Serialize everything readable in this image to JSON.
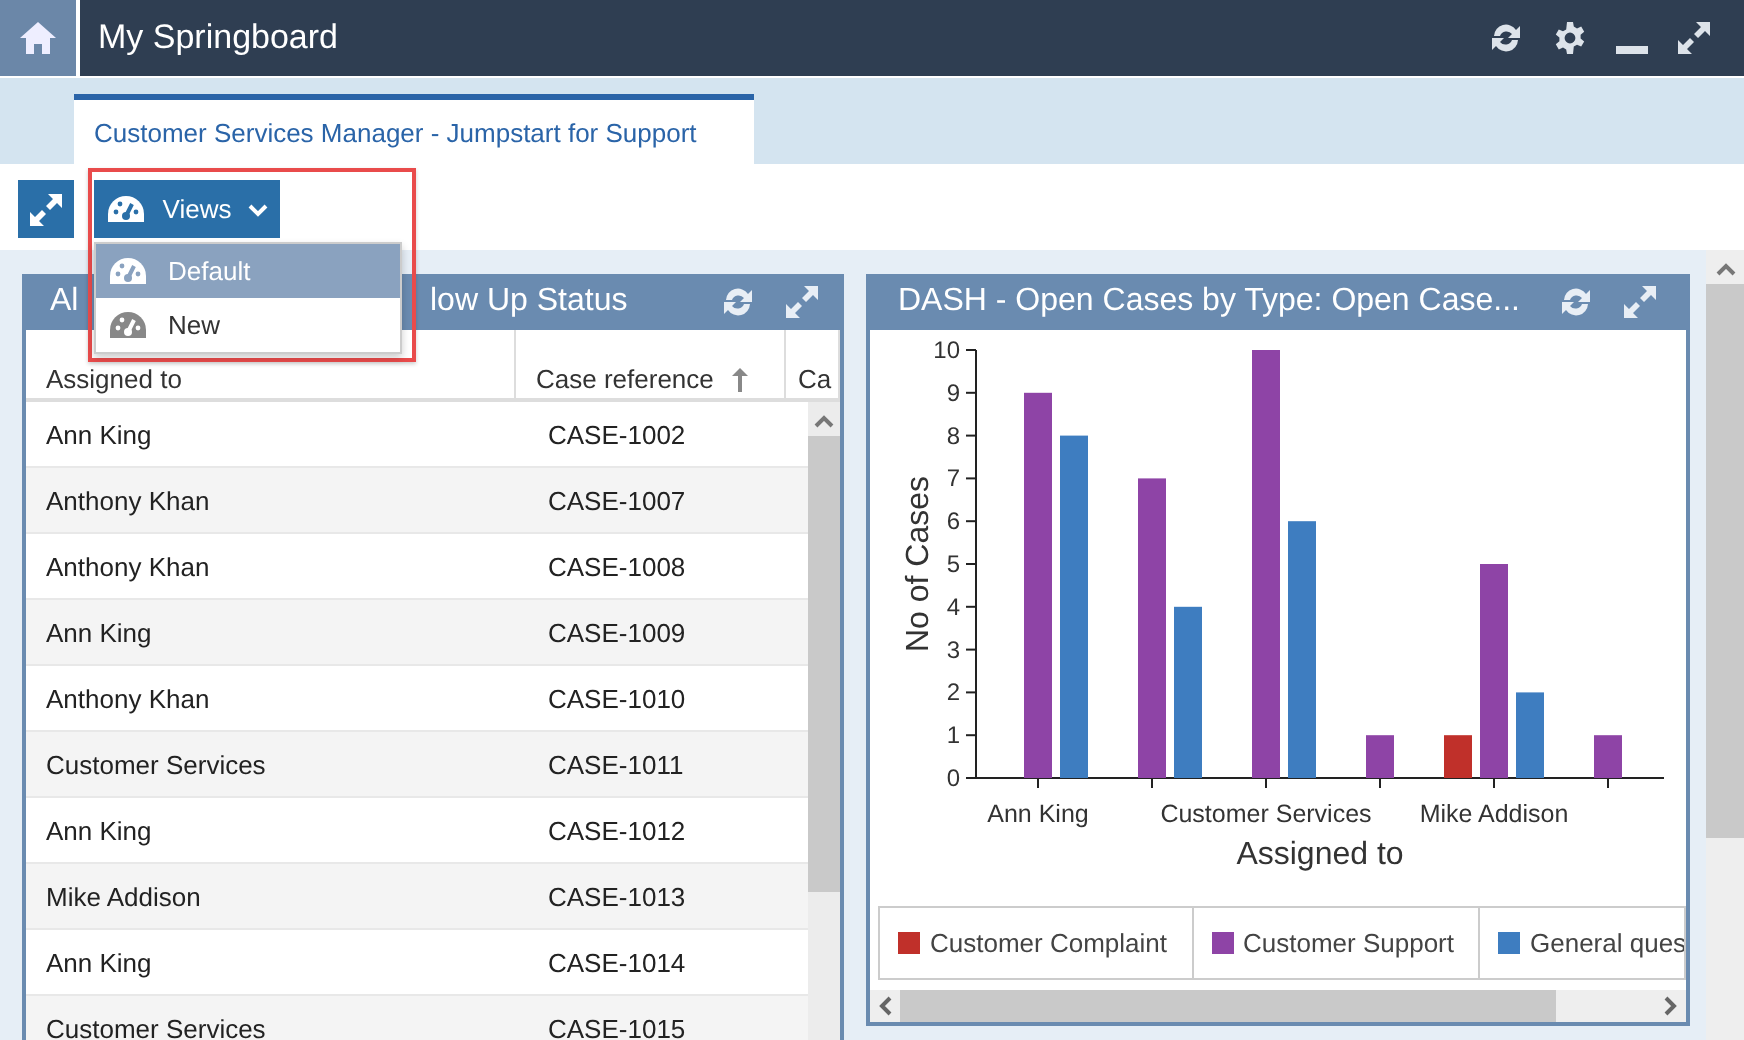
{
  "top_bar": {
    "title": "My Springboard"
  },
  "tabs": [
    {
      "label": "Customer Services Manager - Jumpstart for Support",
      "selected": true
    }
  ],
  "toolbar": {
    "views_button": "Views",
    "views_menu": {
      "expanded": true,
      "items": [
        {
          "label": "Default",
          "selected": true
        },
        {
          "label": "New",
          "selected": false
        }
      ]
    }
  },
  "panels": [
    {
      "kind": "table",
      "title_parts": [
        "Al",
        "low Up Status"
      ],
      "columns": [
        {
          "label": "Assigned to",
          "sorted": false
        },
        {
          "label": "Case reference",
          "sorted": true
        },
        {
          "label": "Ca"
        }
      ],
      "rows": [
        [
          "Ann King",
          "CASE-1002"
        ],
        [
          "Anthony Khan",
          "CASE-1007"
        ],
        [
          "Anthony Khan",
          "CASE-1008"
        ],
        [
          "Ann King",
          "CASE-1009"
        ],
        [
          "Anthony Khan",
          "CASE-1010"
        ],
        [
          "Customer Services",
          "CASE-1011"
        ],
        [
          "Ann King",
          "CASE-1012"
        ],
        [
          "Mike Addison",
          "CASE-1013"
        ],
        [
          "Ann King",
          "CASE-1014"
        ],
        [
          "Customer Services",
          "CASE-1015"
        ]
      ]
    },
    {
      "kind": "chart",
      "title": "DASH - Open Cases by Type: Open Case...",
      "chart_data": {
        "type": "bar",
        "xlabel": "Assigned to",
        "ylabel": "No of Cases",
        "categories": [
          "Ann King",
          null,
          "Customer Services",
          null,
          "Mike Addison",
          null
        ],
        "ylim": [
          0,
          10
        ],
        "yticks": [
          0,
          1,
          2,
          3,
          4,
          5,
          6,
          7,
          8,
          9,
          10
        ],
        "series": [
          {
            "name": "Customer Complaint",
            "color": "#c0302a",
            "values": [
              null,
              null,
              null,
              null,
              1,
              null
            ]
          },
          {
            "name": "Customer Support",
            "color": "#8e44a6",
            "values": [
              9,
              7,
              10,
              1,
              5,
              1
            ]
          },
          {
            "name": "General ques",
            "color": "#3e7dc0",
            "values": [
              8,
              4,
              6,
              null,
              2,
              null
            ]
          }
        ]
      }
    }
  ]
}
